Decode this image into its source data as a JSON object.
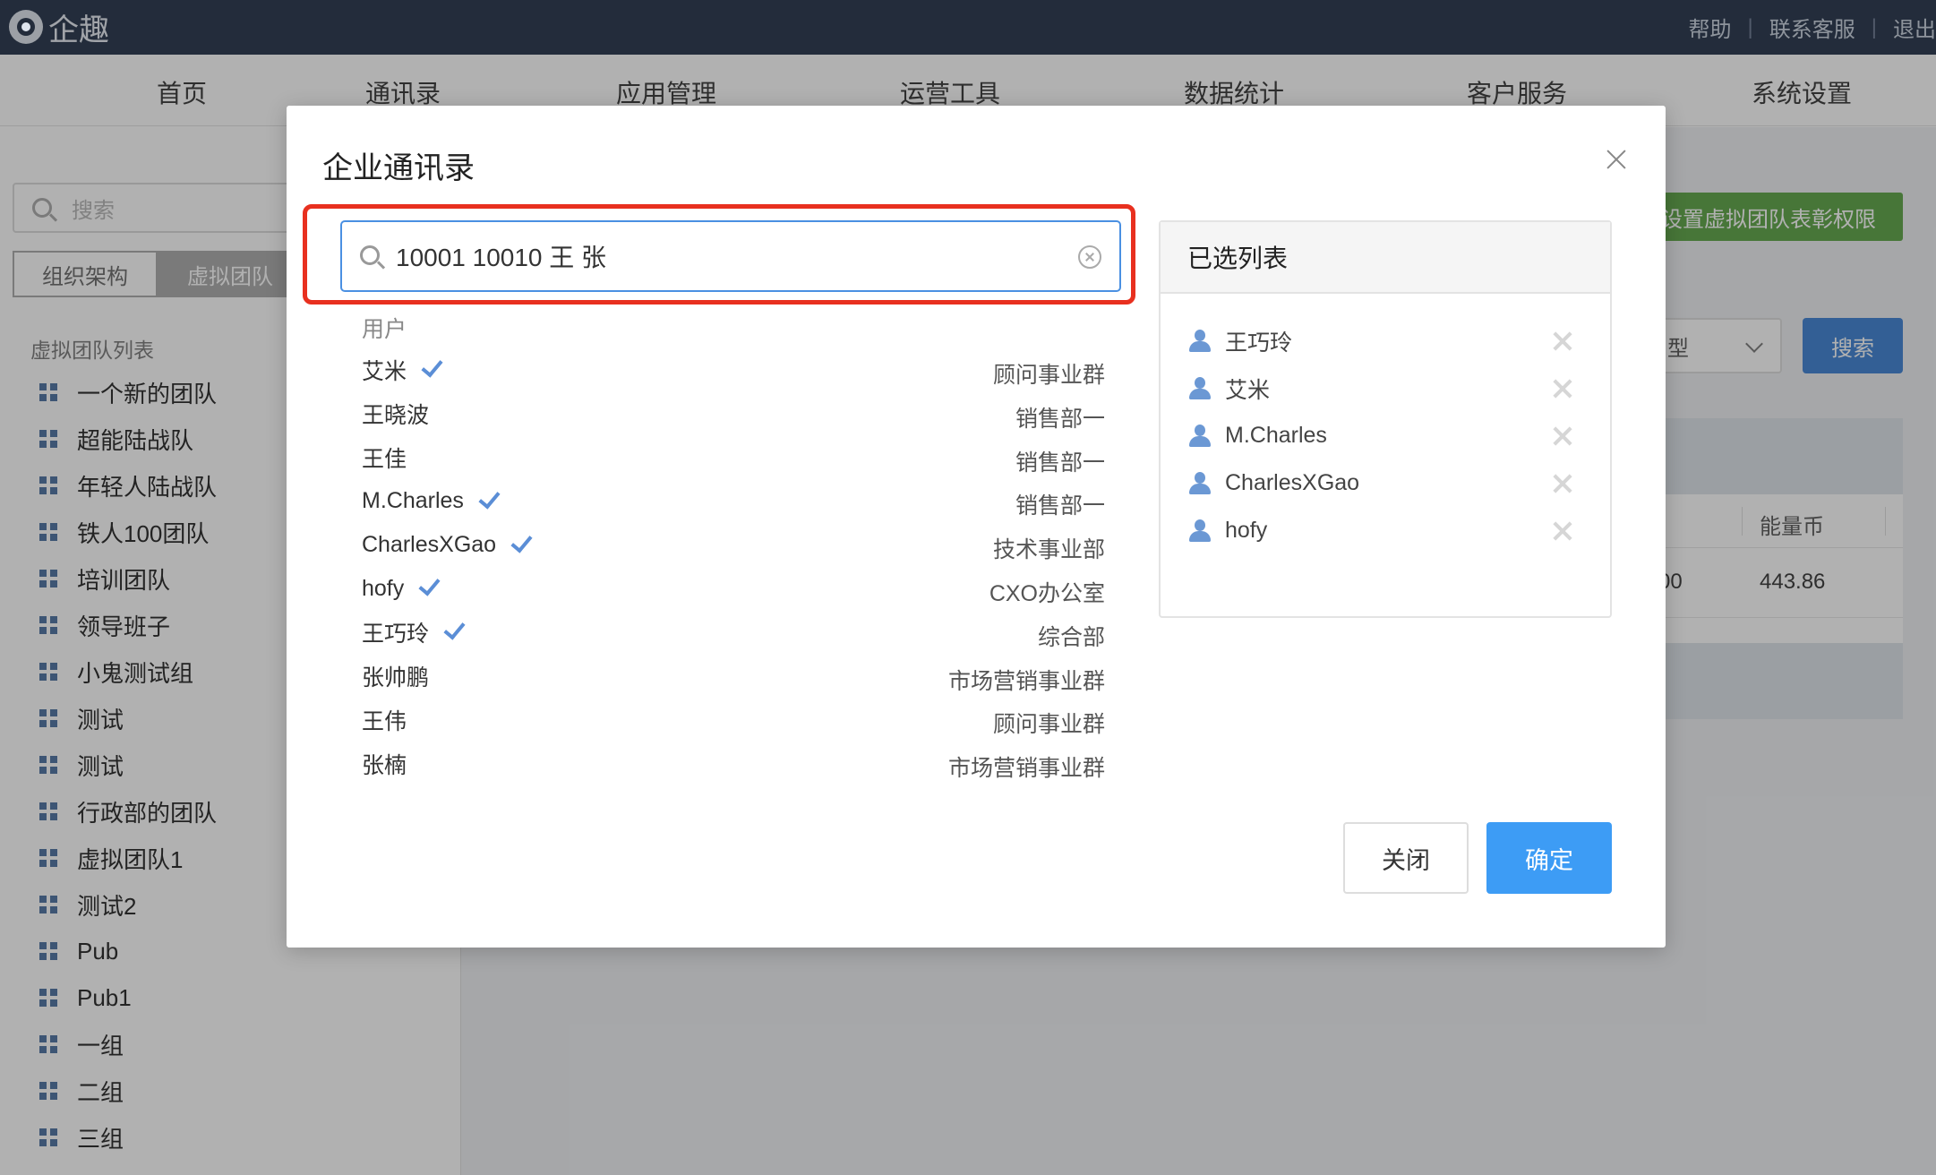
{
  "app": {
    "logo_text": "企趣"
  },
  "top_links": [
    "帮助",
    "联系客服",
    "退出"
  ],
  "nav": [
    "首页",
    "通讯录",
    "应用管理",
    "运营工具",
    "数据统计",
    "客户服务",
    "系统设置"
  ],
  "left_panel": {
    "search_placeholder": "搜索",
    "tabs": [
      "组织架构",
      "虚拟团队"
    ],
    "active_tab": "虚拟团队",
    "heading": "虚拟团队列表",
    "teams": [
      "一个新的团队",
      "超能陆战队",
      "年轻人陆战队",
      "铁人100团队",
      "培训团队",
      "领导班子",
      "小鬼测试组",
      "测试",
      "测试",
      "行政部的团队",
      "虚拟团队1",
      "测试2",
      "Pub",
      "Pub1",
      "一组",
      "二组",
      "三组"
    ]
  },
  "background_right": {
    "green_button": "设置虚拟团队表彰权限",
    "select_text": "型",
    "search_button": "搜索",
    "column_header": "能量币",
    "row_left": "00",
    "row_value": "443.86"
  },
  "dialog": {
    "title": "企业通讯录",
    "search_value": "10001 10010 王 张",
    "section_label": "用户",
    "users": [
      {
        "name": "艾米",
        "dept": "顾问事业群",
        "checked": true
      },
      {
        "name": "王晓波",
        "dept": "销售部一",
        "checked": false
      },
      {
        "name": "王佳",
        "dept": "销售部一",
        "checked": false
      },
      {
        "name": "M.Charles",
        "dept": "销售部一",
        "checked": true
      },
      {
        "name": "CharlesXGao",
        "dept": "技术事业部",
        "checked": true
      },
      {
        "name": "hofy",
        "dept": "CXO办公室",
        "checked": true
      },
      {
        "name": "王巧玲",
        "dept": "综合部",
        "checked": true
      },
      {
        "name": "张帅鹏",
        "dept": "市场营销事业群",
        "checked": false
      },
      {
        "name": "王伟",
        "dept": "顾问事业群",
        "checked": false
      },
      {
        "name": "张楠",
        "dept": "市场营销事业群",
        "checked": false
      }
    ],
    "selected_title": "已选列表",
    "selected": [
      "王巧玲",
      "艾米",
      "M.Charles",
      "CharlesXGao",
      "hofy"
    ],
    "cancel_label": "关闭",
    "ok_label": "确定"
  },
  "colors": {
    "topbar": "#213047",
    "highlight_border": "#e8301f",
    "primary": "#3d9cf5",
    "check": "#5b8ed6"
  }
}
